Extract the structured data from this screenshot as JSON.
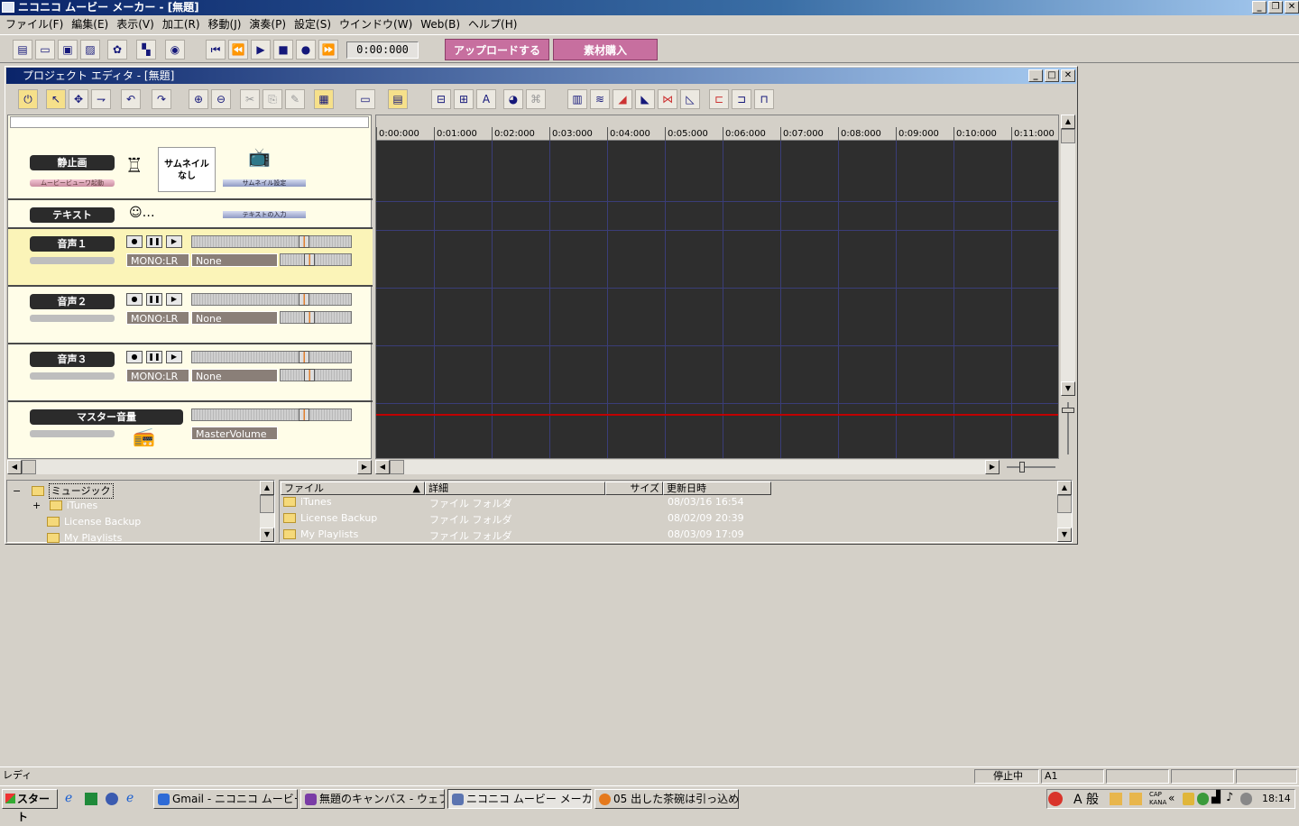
{
  "app": {
    "title": "ニコニコ ムービー メーカー - [無題]"
  },
  "menu": [
    "ファイル(F)",
    "編集(E)",
    "表示(V)",
    "加工(R)",
    "移動(J)",
    "演奏(P)",
    "設定(S)",
    "ウインドウ(W)",
    "Web(B)",
    "ヘルプ(H)"
  ],
  "toolbar": {
    "time": "0:00:000",
    "upload_label": "アップロードする",
    "buy_label": "素材購入"
  },
  "editor": {
    "title": "プロジェクト エディタ - [無題]"
  },
  "tracks": {
    "still": {
      "label": "静止画",
      "sub": "ムービービューワ起動",
      "thumb_line1": "サムネイル",
      "thumb_line2": "なし",
      "thumb_setting": "サムネイル設定"
    },
    "text": {
      "label": "テキスト",
      "input": "テキストの入力"
    },
    "audio": [
      {
        "label": "音声１",
        "mode": "MONO:LR",
        "effect": "None"
      },
      {
        "label": "音声２",
        "mode": "MONO:LR",
        "effect": "None"
      },
      {
        "label": "音声３",
        "mode": "MONO:LR",
        "effect": "None"
      }
    ],
    "master": {
      "label": "マスター音量",
      "field": "MasterVolume"
    }
  },
  "ruler": [
    "0:00:000",
    "0:01:000",
    "0:02:000",
    "0:03:000",
    "0:04:000",
    "0:05:000",
    "0:06:000",
    "0:07:000",
    "0:08:000",
    "0:09:000",
    "0:10:000",
    "0:11:000"
  ],
  "tree": {
    "root": "ミュージック",
    "items": [
      "iTunes",
      "License Backup",
      "My Playlists"
    ]
  },
  "filelist": {
    "headers": {
      "name": "ファイル",
      "detail": "詳細",
      "size": "サイズ",
      "date": "更新日時"
    },
    "rows": [
      {
        "name": "iTunes",
        "detail": "ファイル フォルダ",
        "date": "08/03/16 16:54"
      },
      {
        "name": "License Backup",
        "detail": "ファイル フォルダ",
        "date": "08/02/09 20:39"
      },
      {
        "name": "My Playlists",
        "detail": "ファイル フォルダ",
        "date": "08/03/09 17:09"
      }
    ]
  },
  "status": {
    "ready": "レディ",
    "state": "停止中",
    "cell": "A1"
  },
  "taskbar": {
    "start": "スタート",
    "tasks": [
      "Gmail - ニコニコ ムービー ...",
      "無題のキャンバス - ウェブ...",
      "ニコニコ ムービー メーカ...",
      "05 出した茶碗は引っ込め..."
    ],
    "ime": "A 般",
    "clock": "18:14"
  },
  "colors": {
    "titlebar": "#0a246a",
    "timeline_bg": "#2e2e2e",
    "accent_pink": "#c76f9f",
    "playhead": "#c00000"
  }
}
